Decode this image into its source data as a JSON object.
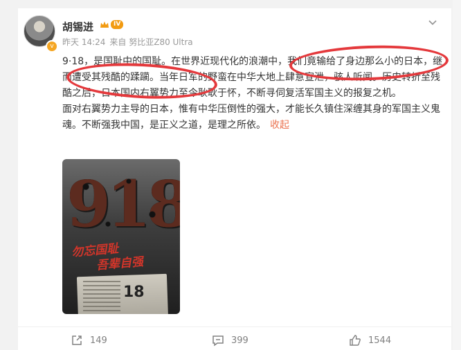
{
  "post": {
    "author": "胡锡进",
    "vip_level": "IV",
    "meta": {
      "time": "昨天 14:24",
      "source": "来自 努比亚Z80 Ultra"
    },
    "paragraphs": [
      "9·18，是国耻中的国耻。在世界近现代化的浪潮中，我们竟输给了身边那么小的日本，继而遭受其残酷的蹂躏。当年日军的野蛮在中华大地上肆意宣泄，骇人听闻。历史转折至残酷之后，日本国内右翼势力至今耿耿于怀，不断寻伺复活军国主义的报复之机。",
      "面对右翼势力主导的日本，惟有中华压倒性的强大，才能长久镇住深缠其身的军国主义鬼魂。不断强我中国，是正义之道，是理之所依。"
    ],
    "collapse_label": "收起",
    "image": {
      "big_number": "918",
      "slogan_line1": "勿忘国耻",
      "slogan_line2": "吾辈自强",
      "paper_date": "18"
    },
    "actions": {
      "share_count": "149",
      "comment_count": "399",
      "like_count": "1544"
    }
  },
  "colors": {
    "highlight_ellipse": "#e4393c",
    "link": "#eb7350",
    "vip": "#f29b12"
  }
}
